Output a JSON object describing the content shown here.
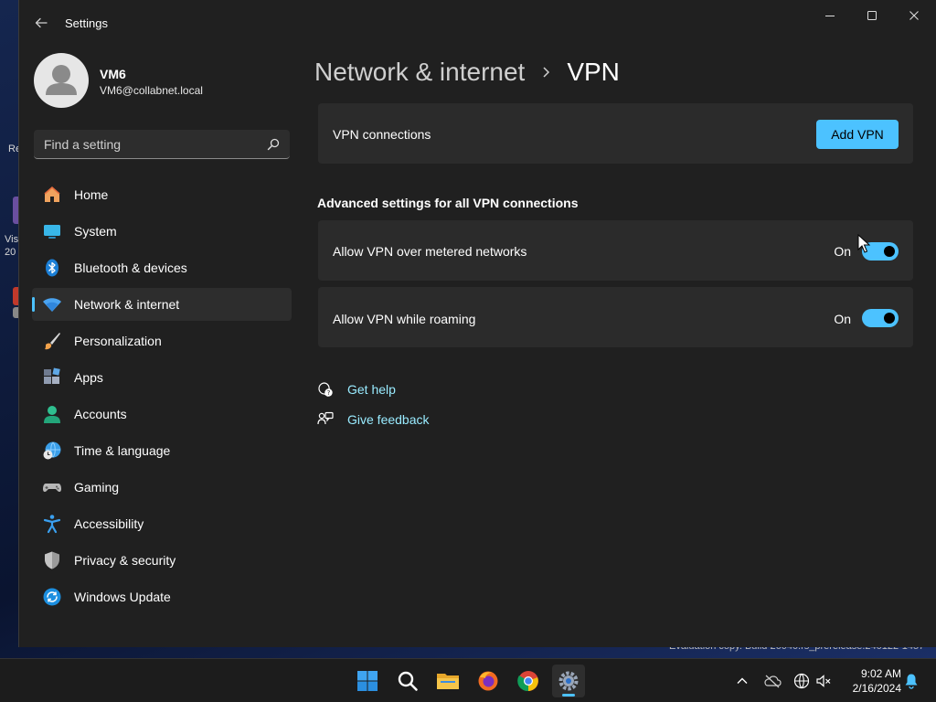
{
  "colors": {
    "accent": "#4cc2ff",
    "window_bg": "#202020",
    "card_bg": "#2b2b2b",
    "link": "#99ebff",
    "taskbar_bg": "#1c1c1c"
  },
  "desktop": {
    "stub_1": "Re",
    "stub_2": "Vis",
    "stub_3": "20",
    "watermark": "Evaluation copy. Build 26040.rs_prerelease.240122-1457"
  },
  "window": {
    "title": "Settings",
    "controls": [
      "minimize-icon",
      "maximize-icon",
      "close-icon"
    ]
  },
  "profile": {
    "name": "VM6",
    "email": "VM6@collabnet.local"
  },
  "search": {
    "placeholder": "Find a setting",
    "value": ""
  },
  "nav": {
    "items": [
      {
        "label": "Home",
        "icon": "home-icon",
        "selected": false
      },
      {
        "label": "System",
        "icon": "system-icon",
        "selected": false
      },
      {
        "label": "Bluetooth & devices",
        "icon": "bluetooth-icon",
        "selected": false
      },
      {
        "label": "Network & internet",
        "icon": "wifi-icon",
        "selected": true
      },
      {
        "label": "Personalization",
        "icon": "brush-icon",
        "selected": false
      },
      {
        "label": "Apps",
        "icon": "apps-icon",
        "selected": false
      },
      {
        "label": "Accounts",
        "icon": "account-icon",
        "selected": false
      },
      {
        "label": "Time & language",
        "icon": "globe-clock-icon",
        "selected": false
      },
      {
        "label": "Gaming",
        "icon": "gamepad-icon",
        "selected": false
      },
      {
        "label": "Accessibility",
        "icon": "accessibility-icon",
        "selected": false
      },
      {
        "label": "Privacy & security",
        "icon": "shield-icon",
        "selected": false
      },
      {
        "label": "Windows Update",
        "icon": "update-icon",
        "selected": false
      }
    ]
  },
  "main": {
    "breadcrumb_parent": "Network & internet",
    "breadcrumb_current": "VPN",
    "vpn_connections_label": "VPN connections",
    "add_vpn_label": "Add VPN",
    "advanced_heading": "Advanced settings for all VPN connections",
    "toggles": [
      {
        "label": "Allow VPN over metered networks",
        "state": "On",
        "on": true
      },
      {
        "label": "Allow VPN while roaming",
        "state": "On",
        "on": true
      }
    ],
    "get_help_label": "Get help",
    "give_feedback_label": "Give feedback"
  },
  "taskbar": {
    "apps": [
      "windows-start-icon",
      "search-icon",
      "file-explorer-icon",
      "firefox-icon",
      "chrome-icon",
      "settings-icon"
    ],
    "active_app": "settings-icon",
    "tray": [
      "chevron-up-icon",
      "onedrive-icon",
      "network-globe-icon",
      "speaker-muted-icon"
    ],
    "time": "9:02 AM",
    "date": "2/16/2024",
    "notification_icon": "bell-icon"
  }
}
